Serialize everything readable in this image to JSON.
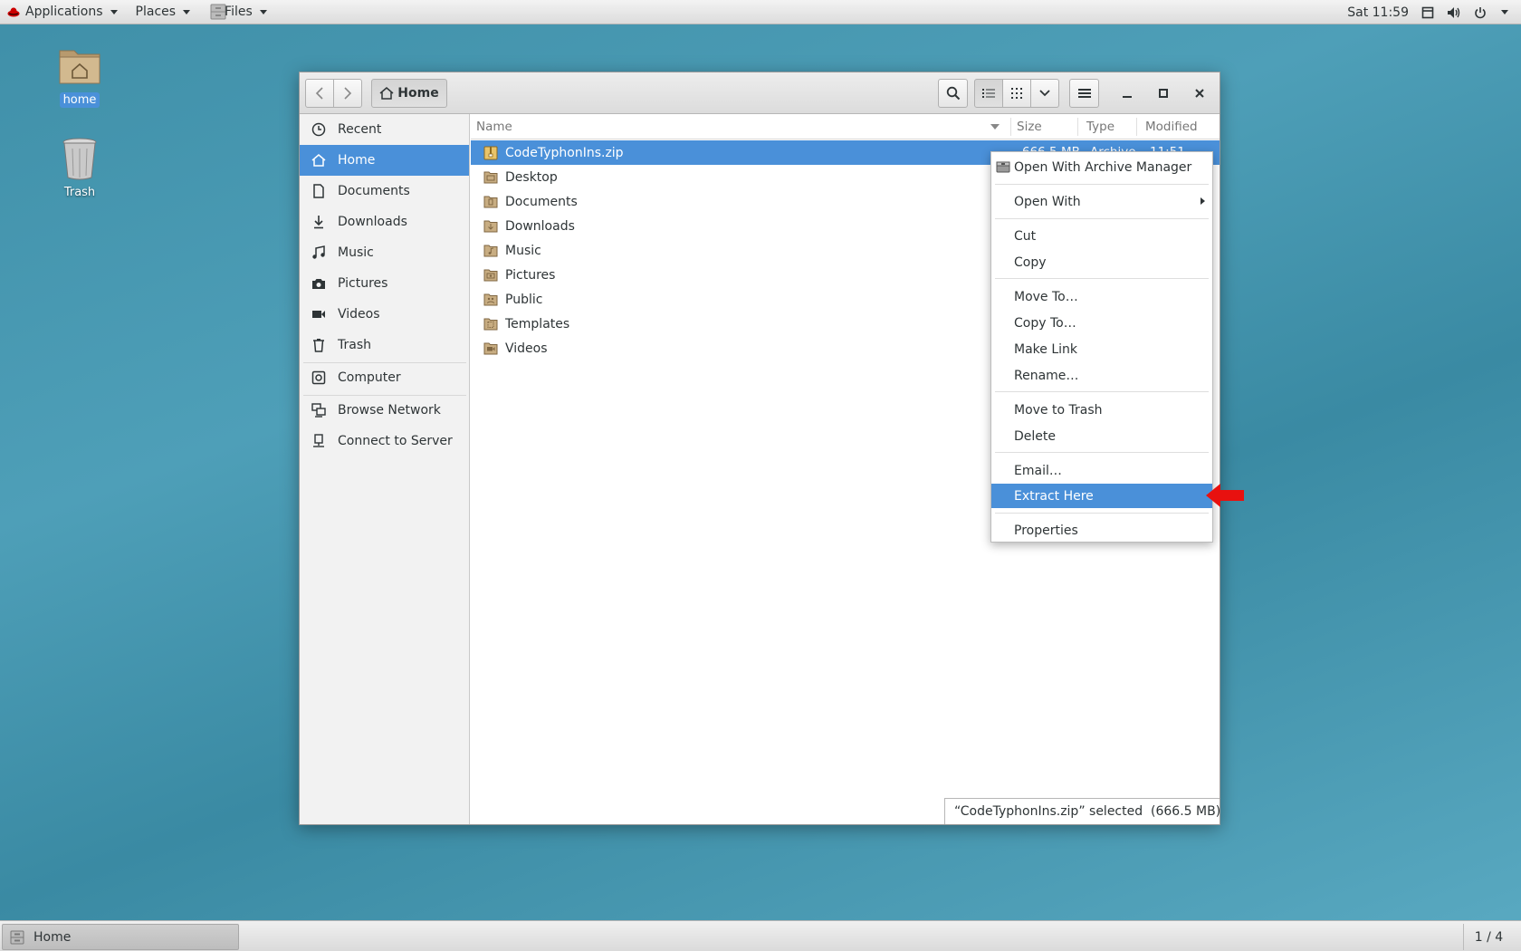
{
  "topbar": {
    "applications": "Applications",
    "places": "Places",
    "files": "Files",
    "clock": "Sat 11:59"
  },
  "desktop": {
    "icons": [
      {
        "label": "home",
        "icon": "home-folder-icon"
      },
      {
        "label": "Trash",
        "icon": "trash-icon"
      }
    ]
  },
  "window": {
    "location": "Home",
    "sidebar": [
      {
        "label": "Recent",
        "icon": "clock-icon"
      },
      {
        "label": "Home",
        "icon": "home-icon"
      },
      {
        "label": "Documents",
        "icon": "document-icon"
      },
      {
        "label": "Downloads",
        "icon": "download-icon"
      },
      {
        "label": "Music",
        "icon": "music-icon"
      },
      {
        "label": "Pictures",
        "icon": "camera-icon"
      },
      {
        "label": "Videos",
        "icon": "video-icon"
      },
      {
        "label": "Trash",
        "icon": "trash-icon"
      },
      {
        "label": "Computer",
        "icon": "computer-icon"
      },
      {
        "label": "Browse Network",
        "icon": "network-icon"
      },
      {
        "label": "Connect to Server",
        "icon": "server-icon"
      }
    ],
    "columns": {
      "name": "Name",
      "size": "Size",
      "type": "Type",
      "modified": "Modified"
    },
    "files": [
      {
        "name": "CodeTyphonIns.zip",
        "size": "666.5 MB",
        "type": "Archive",
        "modified": "11:51",
        "kind": "archive"
      },
      {
        "name": "Desktop",
        "kind": "folder"
      },
      {
        "name": "Documents",
        "kind": "folder"
      },
      {
        "name": "Downloads",
        "kind": "folder"
      },
      {
        "name": "Music",
        "kind": "folder"
      },
      {
        "name": "Pictures",
        "kind": "folder"
      },
      {
        "name": "Public",
        "kind": "folder"
      },
      {
        "name": "Templates",
        "kind": "folder"
      },
      {
        "name": "Videos",
        "kind": "folder"
      }
    ],
    "status": "“CodeTyphonIns.zip” selected  (666.5 MB)"
  },
  "context_menu": {
    "items": [
      {
        "label": "Open With Archive Manager"
      },
      {
        "label": "Open With"
      },
      {
        "label": "Cut"
      },
      {
        "label": "Copy"
      },
      {
        "label": "Move To…"
      },
      {
        "label": "Copy To…"
      },
      {
        "label": "Make Link"
      },
      {
        "label": "Rename…"
      },
      {
        "label": "Move to Trash"
      },
      {
        "label": "Delete"
      },
      {
        "label": "Email…"
      },
      {
        "label": "Extract Here"
      },
      {
        "label": "Properties"
      }
    ]
  },
  "taskbar": {
    "task": "Home",
    "workspace": "1 / 4"
  },
  "colors": {
    "selection": "#4a90d9",
    "annotation_arrow": "#e8110f"
  }
}
